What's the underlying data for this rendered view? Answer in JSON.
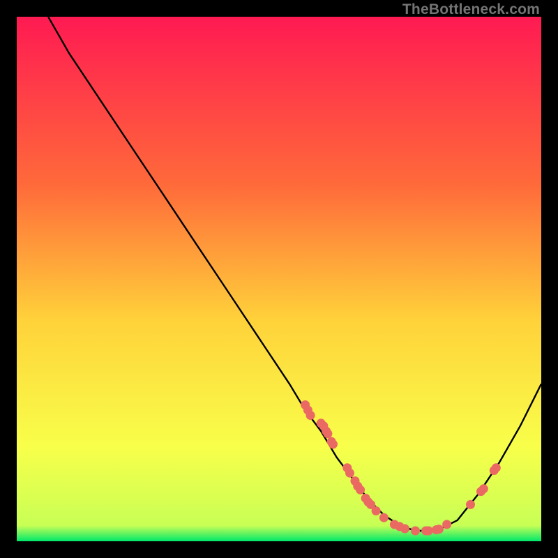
{
  "watermark": "TheBottleneck.com",
  "colors": {
    "frame_bg": "#000000",
    "gradient_top": "#ff1a52",
    "gradient_mid1": "#ff6a3a",
    "gradient_mid2": "#ffd23a",
    "gradient_mid3": "#f8ff4a",
    "gradient_bottom": "#00e86a",
    "curve": "#000000",
    "dot": "#ea6a63"
  },
  "chart_data": {
    "type": "line",
    "title": "",
    "xlabel": "",
    "ylabel": "",
    "xlim": [
      0,
      100
    ],
    "ylim": [
      0,
      100
    ],
    "curve": {
      "x": [
        6,
        10,
        16,
        22,
        28,
        34,
        40,
        46,
        52,
        55,
        58,
        61,
        64,
        67,
        70,
        73,
        76,
        80,
        84,
        88,
        92,
        96,
        100
      ],
      "y": [
        100,
        93,
        84,
        75,
        66,
        57,
        48,
        39,
        30,
        25,
        21,
        16,
        12,
        8,
        5,
        3,
        2,
        2,
        4,
        9,
        15,
        22,
        30
      ]
    },
    "series": [
      {
        "name": "markers",
        "points": [
          {
            "x": 55,
            "y": 26
          },
          {
            "x": 55.5,
            "y": 25
          },
          {
            "x": 56,
            "y": 24
          },
          {
            "x": 58,
            "y": 22.5
          },
          {
            "x": 58.5,
            "y": 22
          },
          {
            "x": 59,
            "y": 21
          },
          {
            "x": 59.3,
            "y": 20.5
          },
          {
            "x": 60,
            "y": 19
          },
          {
            "x": 60.3,
            "y": 18.5
          },
          {
            "x": 63,
            "y": 14
          },
          {
            "x": 63.5,
            "y": 13
          },
          {
            "x": 64.5,
            "y": 11.5
          },
          {
            "x": 65,
            "y": 10.5
          },
          {
            "x": 65.5,
            "y": 9.8
          },
          {
            "x": 66.5,
            "y": 8.2
          },
          {
            "x": 67,
            "y": 7.5
          },
          {
            "x": 67.5,
            "y": 7
          },
          {
            "x": 68.5,
            "y": 5.8
          },
          {
            "x": 70,
            "y": 4.5
          },
          {
            "x": 72,
            "y": 3.2
          },
          {
            "x": 73,
            "y": 2.8
          },
          {
            "x": 74,
            "y": 2.4
          },
          {
            "x": 76,
            "y": 2
          },
          {
            "x": 78,
            "y": 2
          },
          {
            "x": 78.5,
            "y": 2
          },
          {
            "x": 80,
            "y": 2.2
          },
          {
            "x": 80.5,
            "y": 2.3
          },
          {
            "x": 82,
            "y": 3.2
          },
          {
            "x": 86.5,
            "y": 7
          },
          {
            "x": 88.5,
            "y": 9.5
          },
          {
            "x": 89,
            "y": 10
          },
          {
            "x": 91,
            "y": 13.5
          },
          {
            "x": 91.4,
            "y": 14
          }
        ]
      }
    ]
  }
}
